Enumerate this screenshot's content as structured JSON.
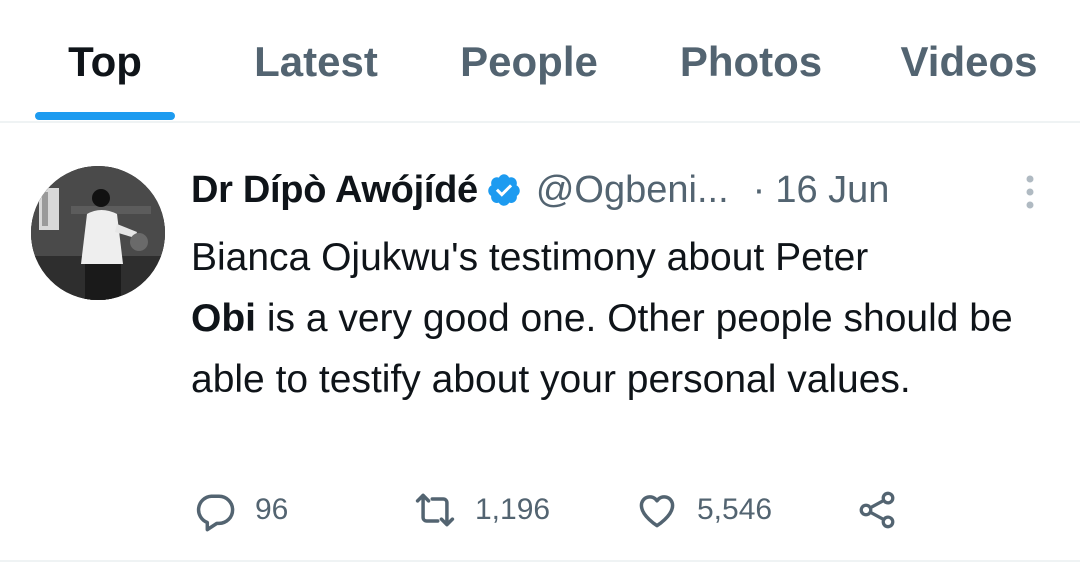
{
  "tabs": [
    {
      "label": "Top",
      "active": true
    },
    {
      "label": "Latest",
      "active": false
    },
    {
      "label": "People",
      "active": false
    },
    {
      "label": "Photos",
      "active": false
    },
    {
      "label": "Videos",
      "active": false
    }
  ],
  "tweet": {
    "author_name": "Dr Dípò Awójídé",
    "verified": true,
    "handle": "@Ogbeni...",
    "separator": "·",
    "time": "16 Jun",
    "text_before": "Bianca Ojukwu's testimony about Peter",
    "text_bold": "Obi",
    "text_after": " is a very good one. Other people should be able to testify about your personal values.",
    "replies": "96",
    "retweets": "1,196",
    "likes": "5,546"
  },
  "icons": {
    "more": "more-vertical-icon",
    "reply": "reply-icon",
    "retweet": "retweet-icon",
    "like": "heart-icon",
    "share": "share-icon",
    "verified": "verified-badge-icon"
  },
  "colors": {
    "accent": "#1d9bf0",
    "primary_text": "#0f1419",
    "secondary_text": "#536471",
    "divider": "#eff3f4"
  }
}
